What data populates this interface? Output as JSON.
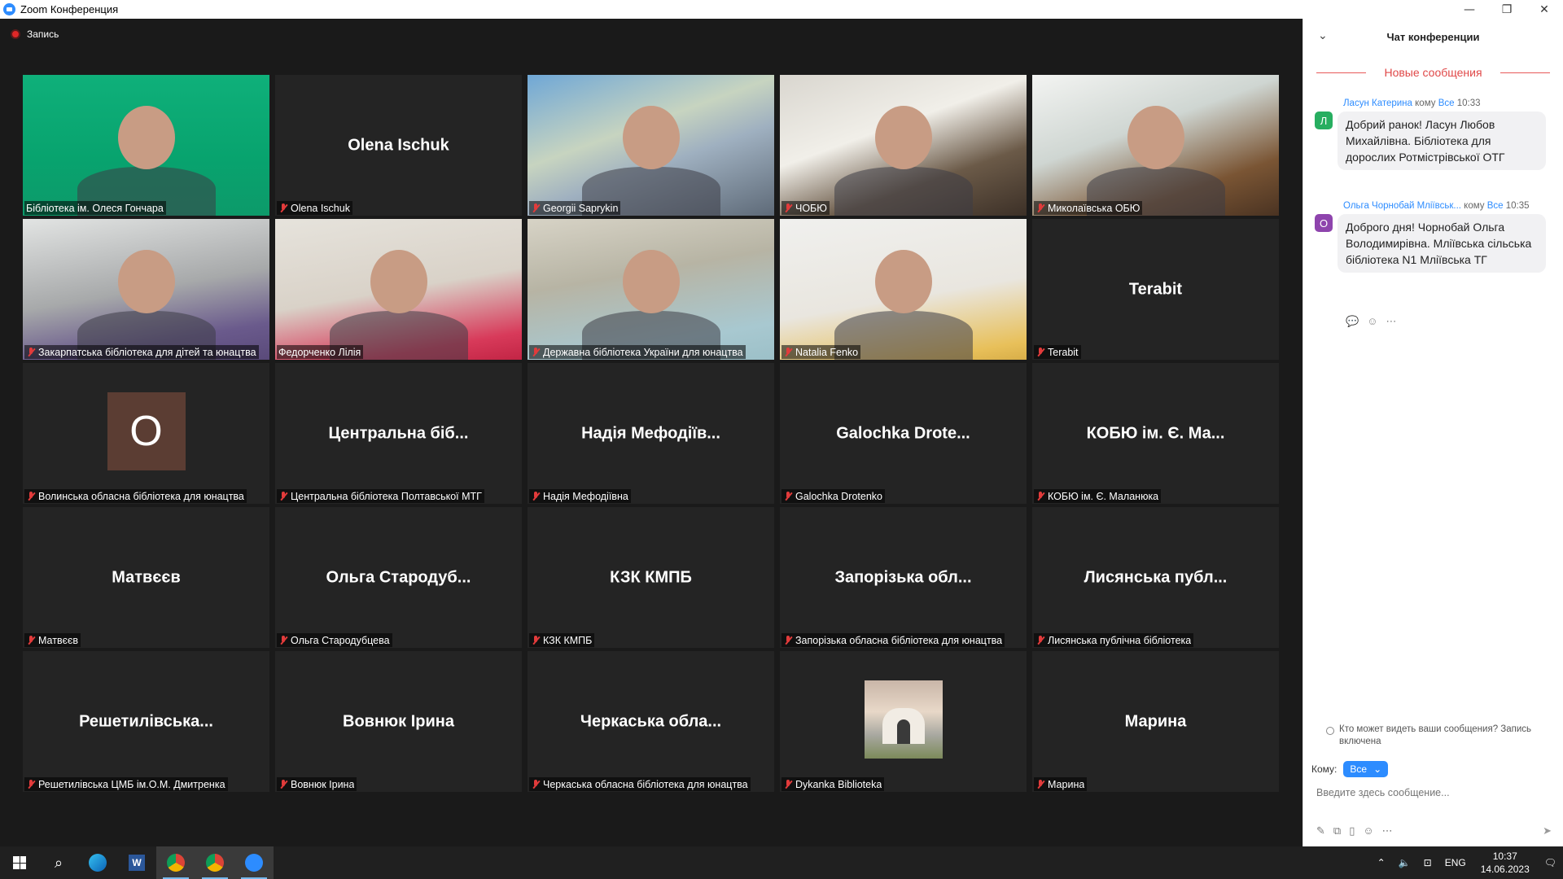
{
  "window": {
    "title": "Zoom Конференция",
    "minimize": "—",
    "restore": "❐",
    "close": "✕"
  },
  "recording": {
    "label": "Запись"
  },
  "tiles": [
    {
      "big": "",
      "name": "Бібліотека ім. Олеся Гончара",
      "video": "v-green"
    },
    {
      "big": "Olena Ischuk",
      "name": "Olena Ischuk",
      "video": ""
    },
    {
      "big": "",
      "name": "Georgii Saprykin",
      "video": "v-map"
    },
    {
      "big": "",
      "name": "ЧОБЮ",
      "video": "v-room1"
    },
    {
      "big": "",
      "name": "Миколаївська ОБЮ",
      "video": "v-room2"
    },
    {
      "big": "",
      "name": "Закарпатська бібліотека для дітей та юнацтва",
      "video": "v-room3"
    },
    {
      "big": "",
      "name": "Федорченко Лілія",
      "video": "v-room4"
    },
    {
      "big": "",
      "name": "Державна бібліотека України для юнацтва",
      "video": "v-room5"
    },
    {
      "big": "",
      "name": "Natalia Fenko",
      "video": "v-room6"
    },
    {
      "big": "Terabit",
      "name": "Terabit",
      "video": ""
    },
    {
      "big": "",
      "name": "Волинська обласна бібліотека для юнацтва",
      "video": "",
      "avatar_letter": "O"
    },
    {
      "big": "Центральна  біб...",
      "name": "Центральна бібліотека Полтавської МТГ",
      "video": ""
    },
    {
      "big": "Надія Мефодіїв...",
      "name": "Надія Мефодіївна",
      "video": ""
    },
    {
      "big": "Galochka  Drote...",
      "name": "Galochka  Drotenko",
      "video": ""
    },
    {
      "big": "КОБЮ ім. Є. Ма...",
      "name": "КОБЮ ім. Є. Маланюка",
      "video": ""
    },
    {
      "big": "Матвєєв",
      "name": "Матвєєв",
      "video": ""
    },
    {
      "big": "Ольга  Стародуб...",
      "name": "Ольга Стародубцева",
      "video": ""
    },
    {
      "big": "КЗК КМПБ",
      "name": "КЗК КМПБ",
      "video": ""
    },
    {
      "big": "Запорізька  обл...",
      "name": "Запорізька обласна бібліотека для юнацтва",
      "video": ""
    },
    {
      "big": "Лисянська  публ...",
      "name": "Лисянська публічна бібліотека",
      "video": ""
    },
    {
      "big": "Решетилівська...",
      "name": "Решетилівська ЦМБ ім.О.М. Дмитренка",
      "video": ""
    },
    {
      "big": "Вовнюк Ірина",
      "name": "Вовнюк Ірина",
      "video": ""
    },
    {
      "big": "Черкаська  обла...",
      "name": "Черкаська обласна бібліотека для юнацтва",
      "video": ""
    },
    {
      "big": "",
      "name": "Dykanka Biblioteka",
      "video": "",
      "avatar_image": true
    },
    {
      "big": "Марина",
      "name": "Марина",
      "video": ""
    }
  ],
  "chat": {
    "title": "Чат конференции",
    "new_messages": "Новые сообщения",
    "messages": [
      {
        "avatar": "Л",
        "avatar_color": "#27ae60",
        "sender": "Ласун Катерина",
        "to_word": "кому",
        "to": "Все",
        "time": "10:33",
        "text": "Добрий ранок! Ласун Любов Михайлівна. Бібліотека для дорослих Ротмістрівської ОТГ"
      },
      {
        "avatar": "О",
        "avatar_color": "#8e44ad",
        "sender": "Ольга Чорнобай Мліївськ...",
        "to_word": "кому",
        "to": "Все",
        "time": "10:35",
        "text": "Доброго дня! Чорнобай Ольга Володимирівна. Мліївська сільська бібліотека N1 Мліївська ТГ"
      }
    ],
    "who_sees": "Кто может видеть ваши сообщения? Запись включена",
    "to_label": "Кому:",
    "to_value": "Все",
    "input_placeholder": "Введите здесь сообщение..."
  },
  "taskbar": {
    "lang": "ENG",
    "time": "10:37",
    "date": "14.06.2023"
  }
}
